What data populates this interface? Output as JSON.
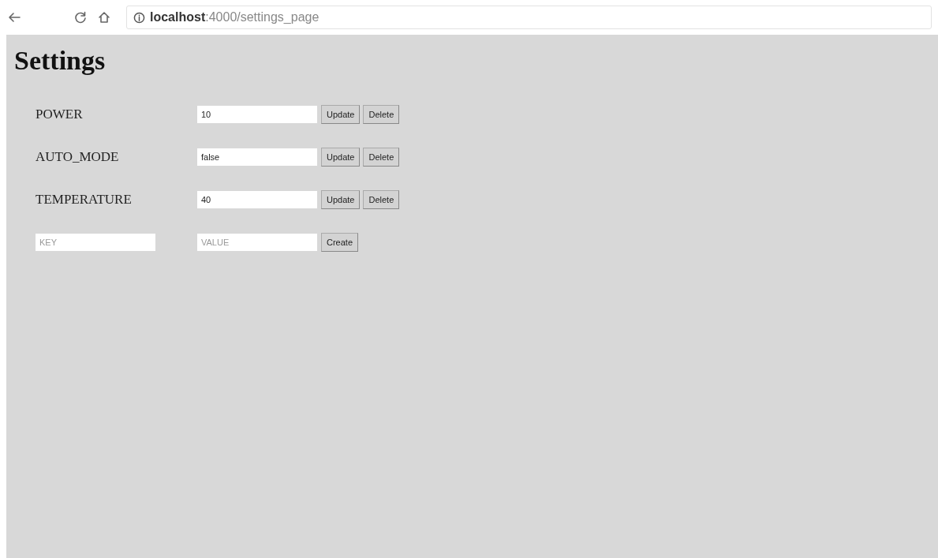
{
  "browser": {
    "url": "**localhost**:4000/settings_page"
  },
  "page": {
    "title": "Settings"
  },
  "settings": [
    {
      "key": "POWER",
      "value": "10",
      "update_label": "Update",
      "delete_label": "Delete"
    },
    {
      "key": "AUTO_MODE",
      "value": "false",
      "update_label": "Update",
      "delete_label": "Delete"
    },
    {
      "key": "TEMPERATURE",
      "value": "40",
      "update_label": "Update",
      "delete_label": "Delete"
    }
  ],
  "new_setting": {
    "key_placeholder": "KEY",
    "value_placeholder": "VALUE",
    "create_label": "Create"
  }
}
